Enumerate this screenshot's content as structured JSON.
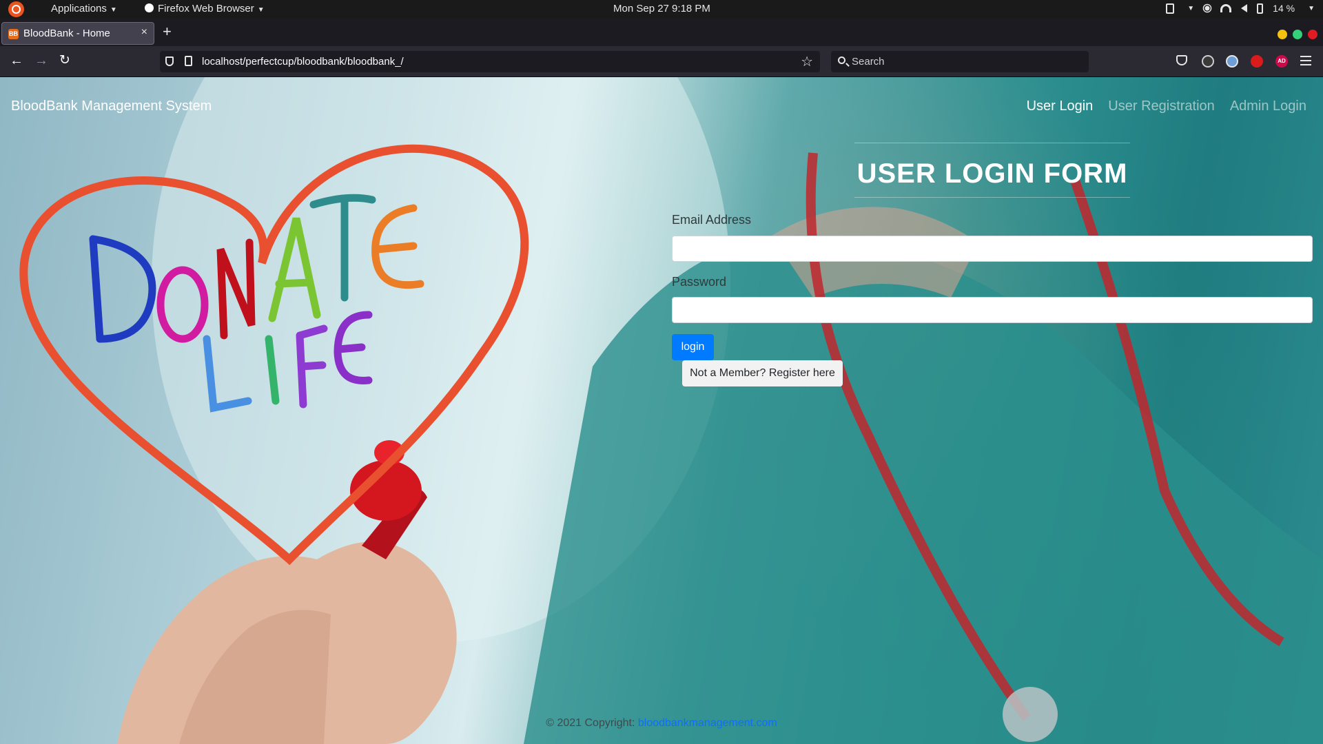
{
  "os": {
    "applications_menu": "Applications",
    "browser_menu": "Firefox Web Browser",
    "clock": "Mon Sep 27  9:18 PM",
    "battery": "14 %"
  },
  "browser": {
    "tab_title": "BloodBank - Home",
    "tab_close": "×",
    "new_tab": "+",
    "url": "localhost/perfectcup/bloodbank/bloodbank_/",
    "search_placeholder": "Search"
  },
  "site": {
    "brand": "BloodBank Management System",
    "nav": {
      "user_login": "User Login",
      "user_registration": "User Registration",
      "admin_login": "Admin Login"
    },
    "form": {
      "title": "USER LOGIN FORM",
      "email_label": "Email Address",
      "email_value": "",
      "password_label": "Password",
      "password_value": "",
      "login_button": "login",
      "register_button": "Not a Member? Register here"
    },
    "footer": {
      "copyright": "© 2021 Copyright: ",
      "link": "bloodbankmanagement.com"
    },
    "hero_text": {
      "line1": "DONATE",
      "line2": "LIFE"
    }
  }
}
